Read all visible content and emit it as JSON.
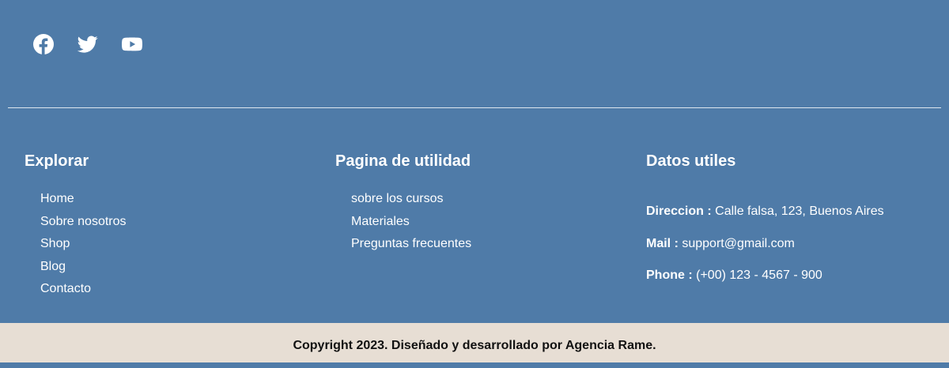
{
  "social": {
    "icons": [
      "facebook-icon",
      "twitter-icon",
      "youtube-icon"
    ],
    "color": "#ffffff"
  },
  "colors": {
    "footer_bg": "#4f7ba8",
    "copyright_bg": "#e7ded4"
  },
  "explore": {
    "title": "Explorar",
    "links": [
      "Home",
      "Sobre nosotros",
      "Shop",
      "Blog",
      "Contacto"
    ]
  },
  "utility": {
    "title": "Pagina de utilidad",
    "links": [
      "sobre los cursos",
      "Materiales",
      "Preguntas frecuentes"
    ]
  },
  "data": {
    "title": "Datos utiles",
    "address_label": "Direccion :",
    "address_value": "Calle falsa, 123, Buenos Aires",
    "mail_label": "Mail :",
    "mail_value": "support@gmail.com",
    "phone_label": "Phone :",
    "phone_value": "(+00) 123 - 4567 - 900"
  },
  "copyright": "Copyright 2023. Diseñado y desarrollado por Agencia Rame."
}
